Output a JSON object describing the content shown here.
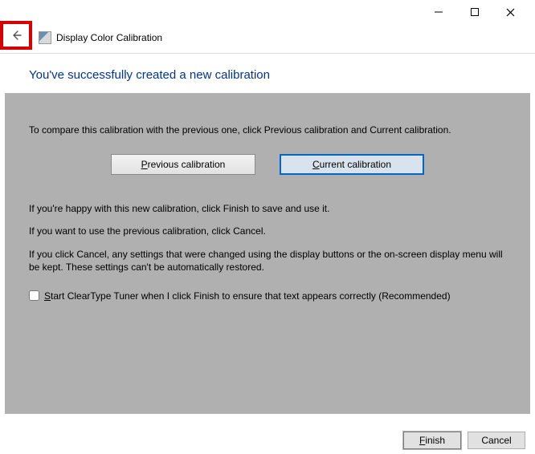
{
  "window": {
    "title": "Display Color Calibration"
  },
  "heading": "You've successfully created a new calibration",
  "body": {
    "compare_instruction": "To compare this calibration with the previous one, click Previous calibration and Current calibration.",
    "happy_text": "If you're happy with this new calibration, click Finish to save and use it.",
    "cancel_text": "If you want to use the previous calibration, click Cancel.",
    "warning_text": "If you click Cancel, any settings that were changed using the display buttons or the on-screen display menu will be kept. These settings can't be automatically restored.",
    "cleartype_prefix": "S",
    "cleartype_rest": "tart ClearType Tuner when I click Finish to ensure that text appears correctly (Recommended)"
  },
  "buttons": {
    "prev_prefix": "P",
    "prev_rest": "revious calibration",
    "curr_prefix": "C",
    "curr_rest": "urrent calibration",
    "finish_prefix": "F",
    "finish_rest": "inish",
    "cancel": "Cancel"
  }
}
